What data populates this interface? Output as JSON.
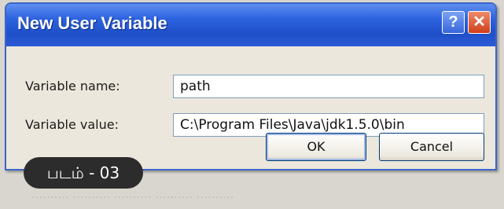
{
  "dialog": {
    "title": "New User Variable",
    "help_glyph": "?",
    "close_glyph": "✕",
    "name_label": "Variable name:",
    "name_value": "path",
    "value_label": "Variable value:",
    "value_value": "C:\\Program Files\\Java\\jdk1.5.0\\bin",
    "ok_label": "OK",
    "cancel_label": "Cancel"
  },
  "caption": {
    "text": "படம் - 03"
  },
  "colors": {
    "titlebar": "#2d63df",
    "close_button": "#cf3f1b",
    "caption_badge": "#2c2c2c"
  },
  "icons": [
    "help-icon",
    "close-icon"
  ]
}
